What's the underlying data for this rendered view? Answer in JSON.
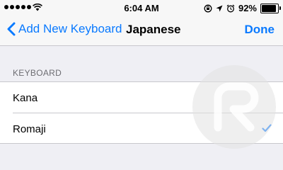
{
  "status_bar": {
    "time": "6:04 AM",
    "battery_label": "92%",
    "battery_level": 0.92,
    "icons": [
      "signal-dots-icon",
      "wifi-icon",
      "rotation-lock-icon",
      "location-arrow-icon",
      "alarm-icon",
      "battery-icon"
    ]
  },
  "nav": {
    "back_label": "Add New Keyboard",
    "title": "Japanese",
    "done_label": "Done",
    "accent_color": "#0a7aff"
  },
  "section": {
    "header": "KEYBOARD",
    "items": [
      {
        "label": "Kana",
        "checked": false
      },
      {
        "label": "Romaji",
        "checked": true
      }
    ]
  },
  "colors": {
    "background": "#efeff4",
    "bar": "#f7f7f7",
    "separator": "#c8c7cc",
    "section_header": "#6d6d72"
  }
}
